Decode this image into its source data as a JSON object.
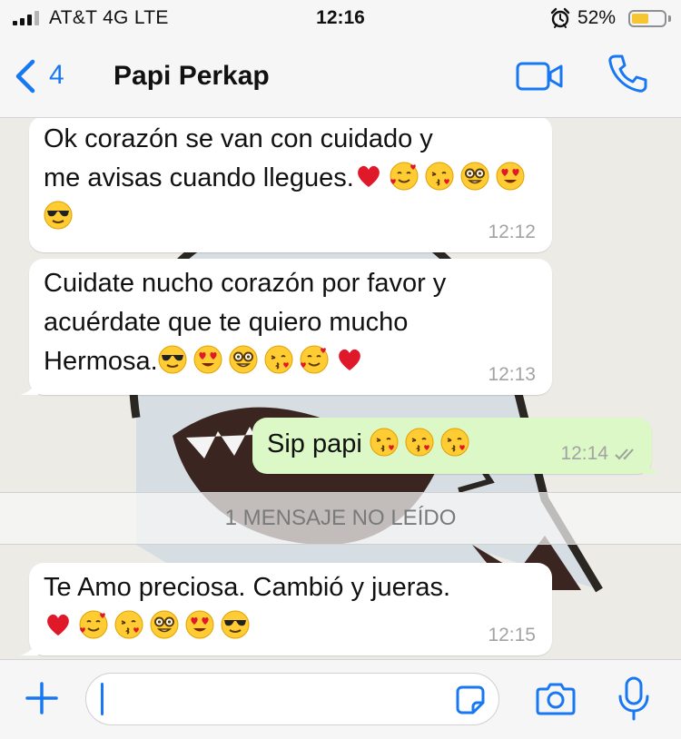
{
  "status_bar": {
    "carrier": "AT&T 4G  LTE",
    "time": "12:16",
    "battery_percent": "52%",
    "battery_level": 0.52,
    "icons": [
      "signal-icon",
      "alarm-icon",
      "battery-icon"
    ]
  },
  "header": {
    "back_count": "4",
    "contact_name": "Papi Perkap",
    "icons": [
      "back-chevron-icon",
      "video-call-icon",
      "phone-icon"
    ]
  },
  "messages": [
    {
      "direction": "incoming",
      "text": "Ok corazón se van con cuidado y\nme avisas cuando llegues.",
      "emojis": [
        "red-heart",
        "smiling-face-with-hearts",
        "face-blowing-kiss",
        "nerd-face",
        "heart-eyes",
        "sunglasses-face"
      ],
      "time": "12:12"
    },
    {
      "direction": "incoming",
      "text": "Cuidate nucho corazón por favor y\nacuérdate que te quiero mucho\nHermosa.",
      "emojis": [
        "sunglasses-face",
        "heart-eyes",
        "nerd-face",
        "face-blowing-kiss",
        "smiling-face-with-hearts",
        "red-heart"
      ],
      "time": "12:13"
    },
    {
      "direction": "outgoing",
      "text": "Sip papi",
      "emojis": [
        "face-blowing-kiss",
        "face-blowing-kiss",
        "face-blowing-kiss"
      ],
      "time": "12:14",
      "status": "delivered"
    },
    {
      "direction": "incoming",
      "text": "Te Amo preciosa. Cambió y jueras.",
      "emojis": [
        "red-heart",
        "smiling-face-with-hearts",
        "face-blowing-kiss",
        "nerd-face",
        "heart-eyes",
        "sunglasses-face"
      ],
      "time": "12:15"
    }
  ],
  "unread_banner": "1 MENSAJE NO LEÍDO",
  "composer": {
    "value": "",
    "icons": [
      "plus-icon",
      "sticker-icon",
      "camera-icon",
      "microphone-icon"
    ]
  },
  "colors": {
    "accent": "#1877f2",
    "outgoing_bubble": "#dcf8c6",
    "incoming_bubble": "#ffffff",
    "battery": "#f7c531"
  }
}
